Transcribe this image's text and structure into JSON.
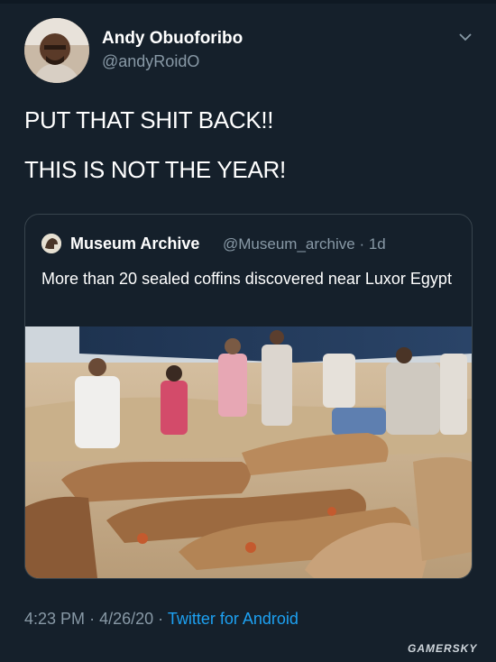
{
  "tweet": {
    "display_name": "Andy Obuoforibo",
    "handle": "@andyRoidO",
    "lines": [
      "PUT THAT SHIT BACK!!",
      "THIS IS NOT THE YEAR!"
    ],
    "time": "4:23 PM",
    "date": "4/26/20",
    "separator": "·",
    "source": "Twitter for Android"
  },
  "quoted_tweet": {
    "display_name": "Museum Archive",
    "handle": "@Museum_archive",
    "age": "1d",
    "separator": "·",
    "text": "More than 20 sealed coffins discovered near Luxor Egypt",
    "photo_description_icon": "photo"
  },
  "watermark": "GAMERSKY",
  "colors": {
    "background": "#15202b",
    "border": "#38444d",
    "secondary_text": "#8899a6",
    "link": "#1da1f2"
  },
  "icons": [
    "chevron-down-icon"
  ]
}
